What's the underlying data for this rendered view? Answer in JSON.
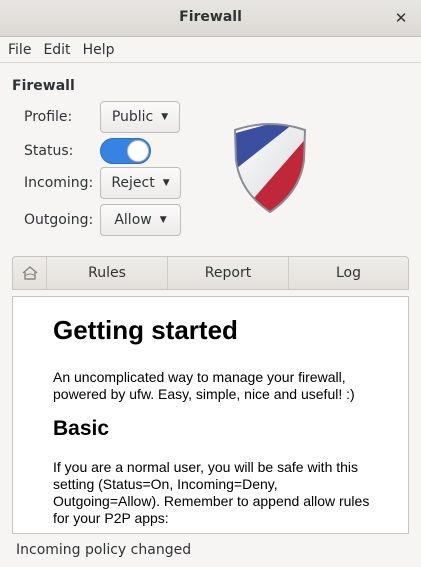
{
  "window": {
    "title": "Firewall",
    "close_glyph": "✕"
  },
  "menu": [
    "File",
    "Edit",
    "Help"
  ],
  "section_title": "Firewall",
  "settings": {
    "profile": {
      "label": "Profile:",
      "value": "Public"
    },
    "status": {
      "label": "Status:",
      "enabled": true
    },
    "incoming": {
      "label": "Incoming:",
      "value": "Reject"
    },
    "outgoing": {
      "label": "Outgoing:",
      "value": "Allow"
    }
  },
  "tabs": {
    "home_icon": "home-icon",
    "items": [
      "Rules",
      "Report",
      "Log"
    ]
  },
  "content": {
    "heading": "Getting started",
    "intro": "An uncomplicated way to manage your firewall, powered by ufw. Easy, simple, nice and useful! :)",
    "subheading": "Basic",
    "basic_text": "If you are a normal user, you will be safe with this setting (Status=On, Incoming=Deny, Outgoing=Allow). Remember to append allow rules for your P2P apps:"
  },
  "statusbar": "Incoming policy changed",
  "colors": {
    "accent": "#3584e4",
    "shield_red": "#c0283a",
    "shield_blue": "#3a4fa0"
  }
}
